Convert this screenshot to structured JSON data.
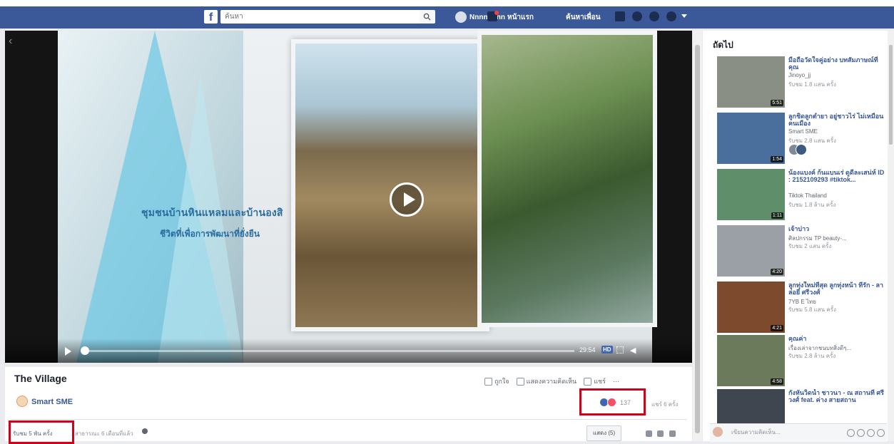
{
  "topbar": {
    "logo": "f",
    "search_placeholder": "ค้นหา",
    "user_name": "Nnnnnnnn",
    "home_link": "หน้าแรก",
    "find_friends_link": "ค้นหาเพื่อน",
    "accent": "#3b5998"
  },
  "video": {
    "overlay_line1": "ชุมชนบ้านหินแหลมและบ้านองสิ",
    "overlay_line2": "ชีวิตที่เพื่อการพัฒนาที่ยั่งยืน",
    "time": "29:54",
    "hd_label": "HD"
  },
  "info": {
    "title": "The Village",
    "like_label": "ถูกใจ",
    "comment_label": "แสดงความคิดเห็น",
    "share_label": "แชร์",
    "more_label": "···",
    "page_name": "Smart SME",
    "reaction_count": "137",
    "shares_text": "แชร์ 6 ครั้ง",
    "views_text": "รับชม 5 พัน ครั้ง",
    "privacy_text": "สาธารณะ 6 เดือนที่แล้ว",
    "comments_filter": "แสดง (5)",
    "highlight_color": "#d0021b"
  },
  "sidebar": {
    "heading": "ถัดไป",
    "items": [
      {
        "title": "มือถือวัดใจคู่อย่าง บทสัมภาษณ์ที่คุณ",
        "channel": "Jinoyo_jj",
        "views": "รับชม 1.8 แสน ครั้ง",
        "duration": "5:51",
        "color": "#8a8f86"
      },
      {
        "title": "ลูกชิดลูกตำยา อยู่ชาวไร่ ไม่เหมือนคนเมือง",
        "channel": "Smart SME",
        "views": "รับชม 2.8 แสน ครั้ง",
        "duration": "1:54",
        "color": "#4a6f9c"
      },
      {
        "title": "น้องแบงค์ ก้นแบนเร่ ดูดีละเสน่ห์ ID : 2152109293 #tiktok...",
        "channel": "Tiktok Thailand",
        "views": "รับชม 1.8 ล้าน ครั้ง",
        "duration": "1:11",
        "color": "#5f8f6a"
      },
      {
        "title": "เจ้าบ่าว",
        "channel": "ศิลปกรรม TP beauty-...",
        "views": "รับชม 2 แสน ครั้ง",
        "duration": "4:20",
        "color": "#9aa0a6"
      },
      {
        "title": "ลูกทุ่งใหม่ที่สุด ลูกทุ่งหน้า ที่รัก - ลาล่อยี่ ศรีวงศ์",
        "channel": "7YB E ไทย",
        "views": "รับชม 5.8 แสน ครั้ง",
        "duration": "4:21",
        "color": "#7d4a2e"
      },
      {
        "title": "คุณค่า",
        "channel": "เรื่องเล่าจากชนบทสิ่งดีๆ...",
        "views": "รับชม 2.8 ล้าน ครั้ง",
        "duration": "4:58",
        "color": "#6b7a5a"
      },
      {
        "title": "กังหันวิดน้ำ ชาวนา - ณ สถานที่ ศรีวงศ์ feat. ค่าง สายสถาน",
        "channel": "",
        "views": "",
        "duration": "",
        "color": "#3f4650"
      }
    ]
  },
  "chat": {
    "placeholder": "เขียนความคิดเห็น..."
  }
}
